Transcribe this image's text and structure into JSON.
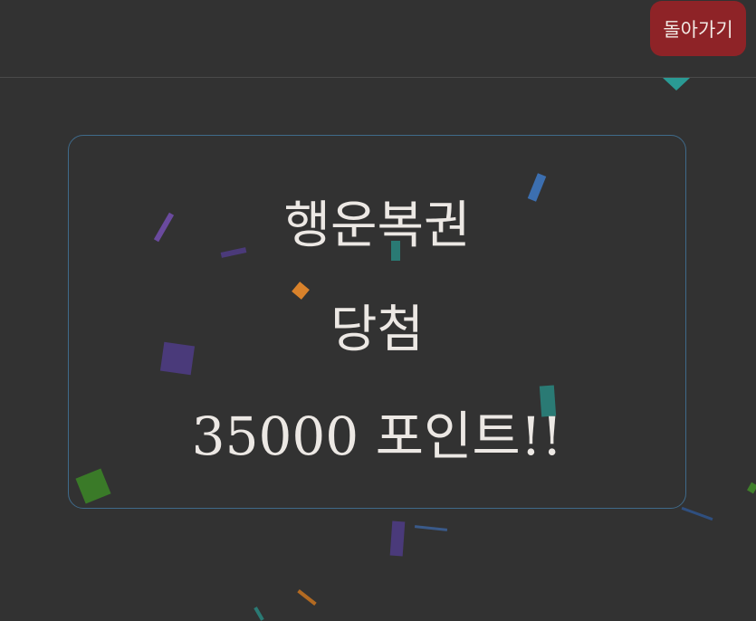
{
  "header": {
    "back_label": "돌아가기"
  },
  "result": {
    "title": "행운복권",
    "status": "당첨",
    "prize": "35000 포인트!!"
  },
  "colors": {
    "background": "#323232",
    "back_button": "#8e2327",
    "card_border": "#3f6a8a",
    "text": "#ece8e4"
  },
  "confetti_colors": [
    "#6a4a9e",
    "#3c6fb0",
    "#2a8a84",
    "#d9822b",
    "#3f7f2a",
    "#2f4f7f"
  ]
}
